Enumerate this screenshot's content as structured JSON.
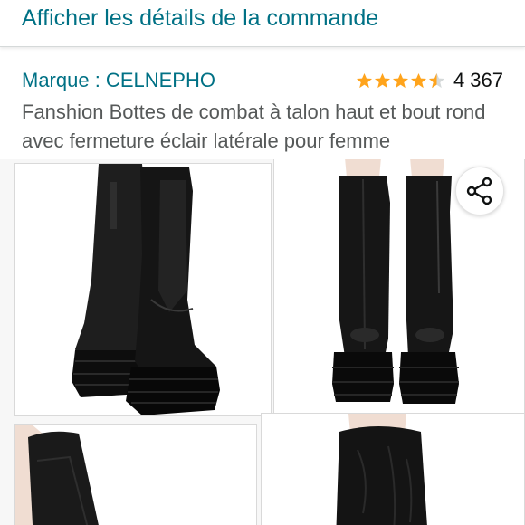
{
  "header": {
    "order_details_link": "Afficher les détails de la commande"
  },
  "product": {
    "brand_label": "Marque : CELNEPHO",
    "rating_value": 4.5,
    "rating_count": "4 367",
    "title": "Fanshion Bottes de combat à talon haut et bout rond avec fermeture éclair latérale pour femme"
  },
  "gallery": {
    "images": [
      {
        "name": "boots-back-view"
      },
      {
        "name": "boots-front-view"
      },
      {
        "name": "boot-side-detail"
      },
      {
        "name": "boot-shaft-closeup"
      }
    ]
  },
  "colors": {
    "link": "#007185",
    "star": "#ffa41c",
    "star_empty": "#d5d9d9",
    "text": "#0f1111",
    "muted_text": "#565959",
    "boot": "#151515"
  },
  "icons": {
    "share": "share-icon",
    "star": "star-icon"
  }
}
